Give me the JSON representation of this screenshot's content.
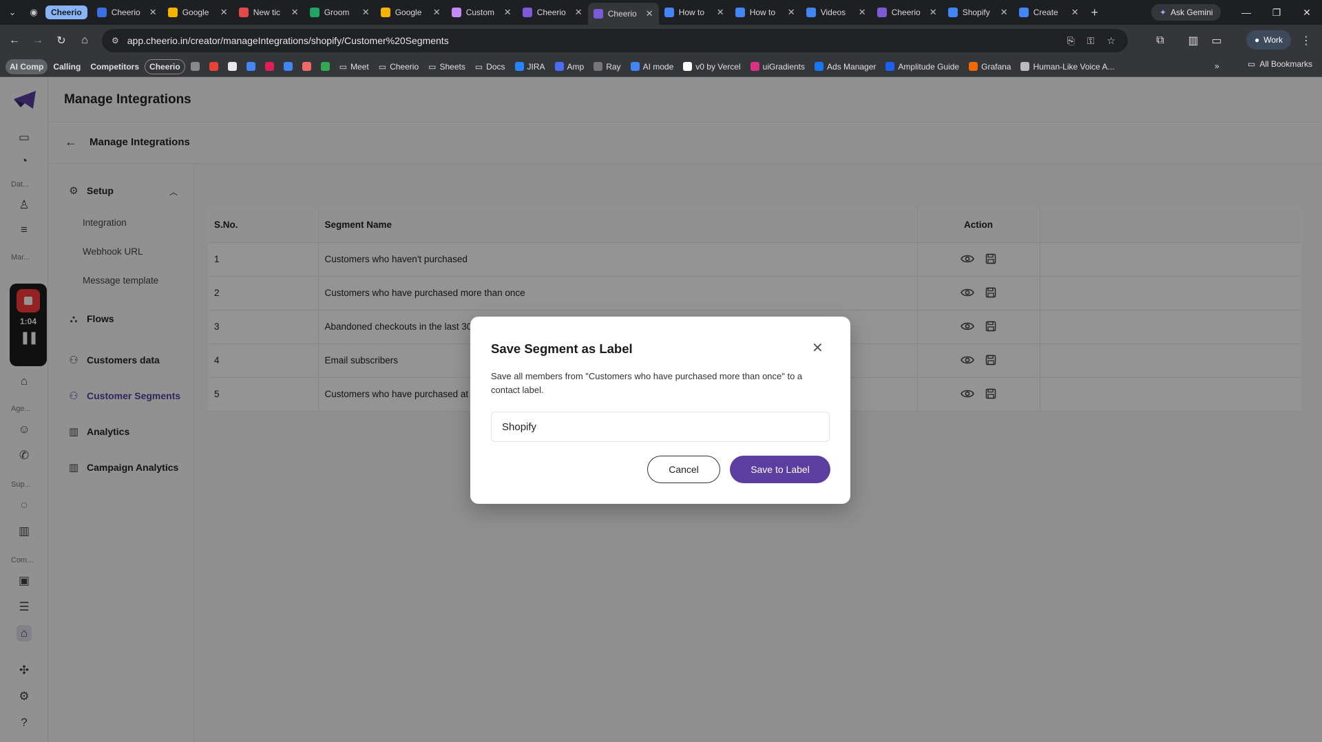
{
  "browser": {
    "tab_group_label": "Cheerio",
    "tabs": [
      {
        "label": "Cheerio",
        "color": "#3b6fe0",
        "active": false
      },
      {
        "label": "Google",
        "color": "#f4b400",
        "active": false
      },
      {
        "label": "New tic",
        "color": "#e04a4a",
        "active": false
      },
      {
        "label": "Groom",
        "color": "#1fa463",
        "active": false
      },
      {
        "label": "Google",
        "color": "#f4b400",
        "active": false
      },
      {
        "label": "Custom",
        "color": "#c58af9",
        "active": false
      },
      {
        "label": "Cheerio",
        "color": "#7b5bd6",
        "active": false
      },
      {
        "label": "Cheerio",
        "color": "#7b5bd6",
        "active": true
      },
      {
        "label": "How to",
        "color": "#4285f4",
        "active": false
      },
      {
        "label": "How to",
        "color": "#4285f4",
        "active": false
      },
      {
        "label": "Videos",
        "color": "#4285f4",
        "active": false
      },
      {
        "label": "Cheerio",
        "color": "#7b5bd6",
        "active": false
      },
      {
        "label": "Shopify",
        "color": "#4285f4",
        "active": false
      },
      {
        "label": "Create",
        "color": "#4285f4",
        "active": false
      }
    ],
    "ask_gemini": "Ask Gemini",
    "url": "app.cheerio.in/creator/manageIntegrations/shopify/Customer%20Segments",
    "profile": "Work",
    "bookmarks": [
      {
        "label": "AI Comp",
        "style": "pill",
        "color": ""
      },
      {
        "label": "Calling",
        "style": "plain-bold",
        "color": ""
      },
      {
        "label": "Competitors",
        "style": "plain-bold",
        "color": ""
      },
      {
        "label": "Cheerio",
        "style": "outline",
        "color": ""
      },
      {
        "label": "",
        "style": "icon",
        "color": "#888888"
      },
      {
        "label": "",
        "style": "icon",
        "color": "#ea4335"
      },
      {
        "label": "",
        "style": "icon",
        "color": "#e8e8e8"
      },
      {
        "label": "",
        "style": "icon",
        "color": "#4285f4"
      },
      {
        "label": "",
        "style": "icon",
        "color": "#e01e5a"
      },
      {
        "label": "",
        "style": "icon",
        "color": "#4285f4"
      },
      {
        "label": "",
        "style": "icon",
        "color": "#f06a6a"
      },
      {
        "label": "",
        "style": "icon",
        "color": "#34a853"
      },
      {
        "label": "Meet",
        "style": "folder",
        "color": ""
      },
      {
        "label": "Cheerio",
        "style": "folder",
        "color": ""
      },
      {
        "label": "Sheets",
        "style": "folder",
        "color": ""
      },
      {
        "label": "Docs",
        "style": "folder",
        "color": ""
      },
      {
        "label": "JIRA",
        "style": "fav",
        "color": "#2684ff"
      },
      {
        "label": "Amp",
        "style": "fav",
        "color": "#4a6cf7"
      },
      {
        "label": "Ray",
        "style": "fav",
        "color": "#777777"
      },
      {
        "label": "AI mode",
        "style": "fav",
        "color": "#4285f4"
      },
      {
        "label": "v0 by Vercel",
        "style": "fav",
        "color": "#ffffff"
      },
      {
        "label": "uiGradients",
        "style": "fav",
        "color": "#d63384"
      },
      {
        "label": "Ads Manager",
        "style": "fav",
        "color": "#1877f2"
      },
      {
        "label": "Amplitude Guide",
        "style": "fav",
        "color": "#1e61f0"
      },
      {
        "label": "Grafana",
        "style": "fav",
        "color": "#f46800"
      },
      {
        "label": "Human-Like Voice A...",
        "style": "fav",
        "color": "#bbbbbb"
      }
    ],
    "all_bookmarks": "All Bookmarks"
  },
  "rail": {
    "sections": [
      "Dat...",
      "Mar...",
      "Age...",
      "Sup...",
      "Com..."
    ],
    "recorder_time": "1:04"
  },
  "app": {
    "title": "Manage Integrations",
    "subtitle": "Manage Integrations",
    "nav": {
      "setup": "Setup",
      "sub_items": [
        "Integration",
        "Webhook URL",
        "Message template"
      ],
      "flows": "Flows",
      "customers_data": "Customers data",
      "customer_segments": "Customer Segments",
      "analytics": "Analytics",
      "campaign_analytics": "Campaign Analytics"
    },
    "table": {
      "headers": {
        "sno": "S.No.",
        "name": "Segment Name",
        "action": "Action"
      },
      "rows": [
        {
          "sno": "1",
          "name": "Customers who haven't purchased"
        },
        {
          "sno": "2",
          "name": "Customers who have purchased more than once"
        },
        {
          "sno": "3",
          "name": "Abandoned checkouts in the last 30"
        },
        {
          "sno": "4",
          "name": "Email subscribers"
        },
        {
          "sno": "5",
          "name": "Customers who have purchased at l"
        }
      ]
    }
  },
  "modal": {
    "title": "Save Segment as Label",
    "description": "Save all members from \"Customers who have purchased more than once\" to a contact label.",
    "input_value": "Shopify",
    "cancel": "Cancel",
    "save": "Save to Label"
  },
  "colors": {
    "accent": "#5b3ea0",
    "active_tab": "#35363a"
  }
}
